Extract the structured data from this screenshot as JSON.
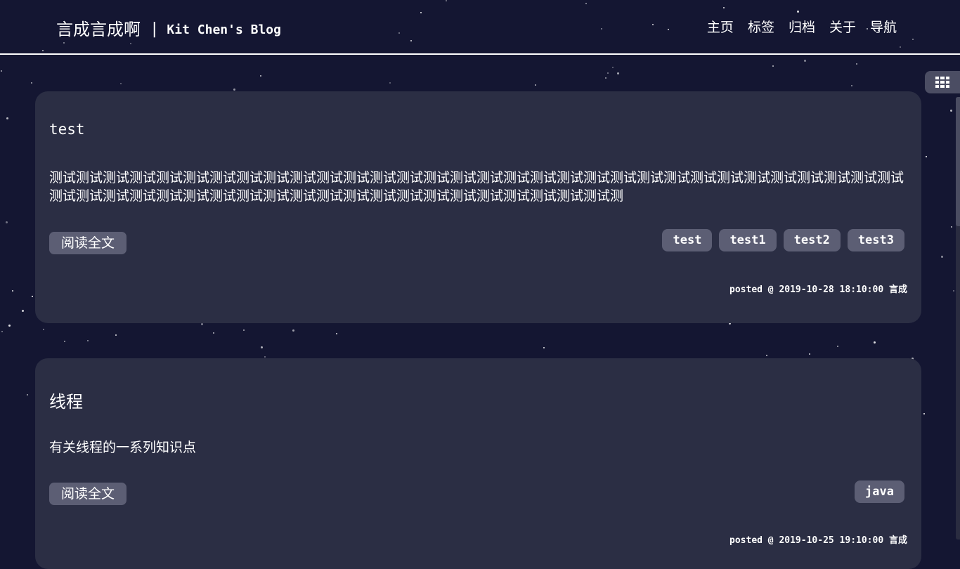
{
  "header": {
    "brand_name": "言成言成啊",
    "separator": "|",
    "subtitle": "Kit Chen's Blog",
    "nav": [
      "主页",
      "标签",
      "归档",
      "关于",
      "导航"
    ]
  },
  "toolbar": {
    "grid_icon": "grid-icon"
  },
  "posts": [
    {
      "title": "test",
      "excerpt": "测试测试测试测试测试测试测试测试测试测试测试测试测试测试测试测试测试测试测试测试测试测试测试测试测试测试测试测试测试测试测试测试测试测试测试测试测试测试测试测试测试测试测试测试测试测试测试测试测试测试测试测试测试测",
      "read_more": "阅读全文",
      "tags": [
        "test",
        "test1",
        "test2",
        "test3"
      ],
      "posted": "posted @ 2019-10-28 18:10:00 言成"
    },
    {
      "title": "线程",
      "excerpt": "有关线程的一系列知识点",
      "read_more": "阅读全文",
      "tags": [
        "java"
      ],
      "posted": "posted @ 2019-10-25 19:10:00 言成"
    }
  ],
  "colors": {
    "background": "#141632",
    "card": "#2b2e44",
    "button": "#5c5e74"
  }
}
